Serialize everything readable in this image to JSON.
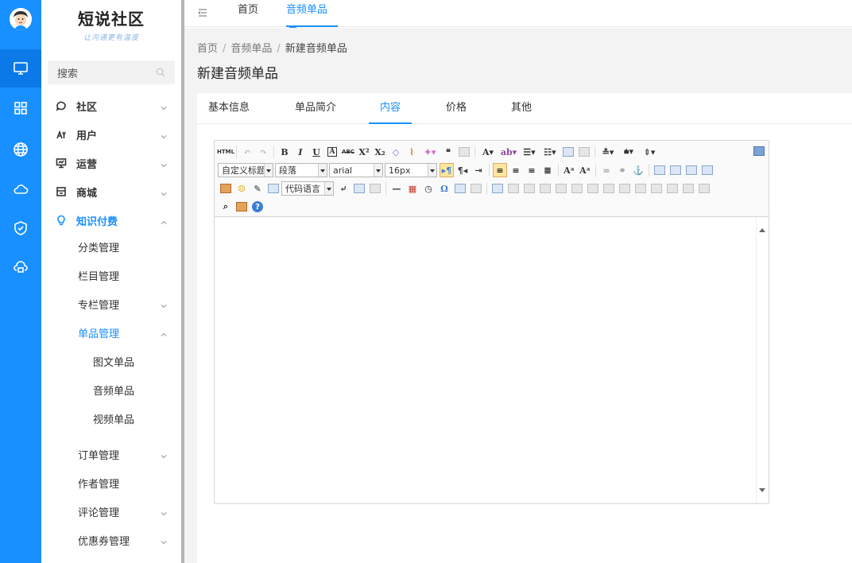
{
  "app": {
    "logo_title": "短说社区",
    "logo_subtitle": "让沟通更有温度"
  },
  "search": {
    "placeholder": "搜索"
  },
  "icon_bar": [
    "monitor-icon",
    "grid-icon",
    "globe-icon",
    "cloud-icon",
    "shield-icon",
    "cloud-print-icon"
  ],
  "menu": {
    "items": [
      {
        "label": "社区",
        "icon": "chat-icon"
      },
      {
        "label": "用户",
        "icon": "users-icon"
      },
      {
        "label": "运营",
        "icon": "screen-icon"
      },
      {
        "label": "商城",
        "icon": "store-icon"
      },
      {
        "label": "知识付费",
        "icon": "bulb-icon"
      }
    ],
    "knowledge_sub": [
      {
        "label": "分类管理"
      },
      {
        "label": "栏目管理"
      },
      {
        "label": "专栏管理"
      },
      {
        "label": "单品管理"
      }
    ],
    "single_sub": [
      {
        "label": "图文单品"
      },
      {
        "label": "音频单品"
      },
      {
        "label": "视频单品"
      }
    ],
    "more_sub": [
      {
        "label": "订单管理"
      },
      {
        "label": "作者管理"
      },
      {
        "label": "评论管理"
      },
      {
        "label": "优惠券管理"
      }
    ]
  },
  "top_tabs": [
    {
      "label": "首页"
    },
    {
      "label": "音频单品"
    }
  ],
  "breadcrumb": {
    "home": "首页",
    "parent": "音频单品",
    "current": "新建音频单品"
  },
  "page_title": "新建音频单品",
  "content_tabs": [
    {
      "label": "基本信息"
    },
    {
      "label": "单品简介"
    },
    {
      "label": "内容"
    },
    {
      "label": "价格"
    },
    {
      "label": "其他"
    }
  ],
  "editor": {
    "html_label": "HTML",
    "heading_select": "自定义标题",
    "paragraph_select": "段落",
    "font_select": "arial",
    "size_select": "16px",
    "code_select": "代码语言",
    "help": "?"
  },
  "colors": {
    "accent": "#1890ff",
    "icon_bar": "#1890ff"
  }
}
